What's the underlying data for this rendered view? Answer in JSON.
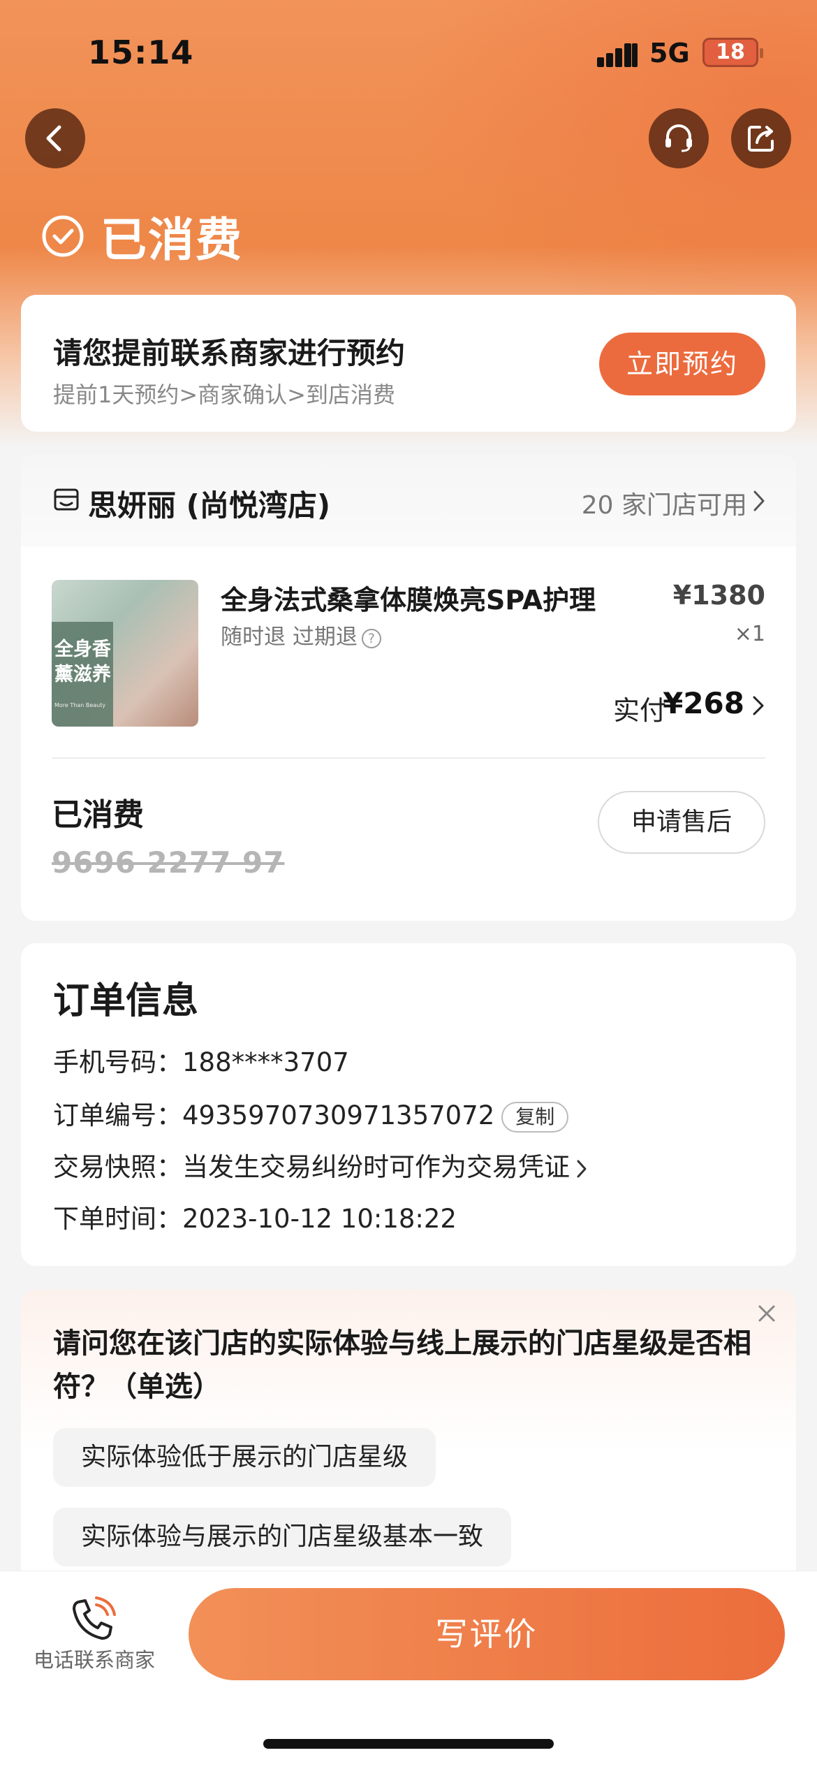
{
  "status_bar": {
    "time": "15:14",
    "network": "5G",
    "battery": "18",
    "battery_color": "#e2603f"
  },
  "nav": {
    "back_icon": "chevron-left-icon",
    "service_icon": "headset-icon",
    "share_icon": "share-icon"
  },
  "order_status": {
    "text": "已消费",
    "icon": "check-circle-icon"
  },
  "booking": {
    "title": "请您提前联系商家进行预约",
    "steps": "提前1天预约>商家确认>到店消费",
    "button": "立即预约"
  },
  "store": {
    "name": "思妍丽 (尚悦湾店)",
    "available": "20 家门店可用"
  },
  "product": {
    "thumb_text": "全身香薰滋养",
    "thumb_sub": "More Than Beauty",
    "name": "全身法式桑拿体膜焕亮SPA护理",
    "original_price": "¥1380",
    "refund_policy": "随时退 过期退",
    "quantity": "×1",
    "paid_label": "实付",
    "paid_amount": "¥268"
  },
  "voucher": {
    "status": "已消费",
    "code": "9696 2277 97",
    "aftersale_button": "申请售后"
  },
  "order_info": {
    "title": "订单信息",
    "phone_key": "手机号码：",
    "phone_value": "188****3707",
    "order_no_key": "订单编号：",
    "order_no_value": "4935970730971357072",
    "copy_button": "复制",
    "snapshot_key": "交易快照：",
    "snapshot_value": "当发生交易纠纷时可作为交易凭证",
    "time_key": "下单时间：",
    "time_value": "2023-10-12 10:18:22"
  },
  "survey": {
    "question": "请问您在该门店的实际体验与线上展示的门店星级是否相符？（单选）",
    "options": [
      "实际体验低于展示的门店星级",
      "实际体验与展示的门店星级基本一致"
    ]
  },
  "bottom": {
    "call_label": "电话联系商家",
    "review_button": "写评价",
    "accent": "#ec6d3c"
  }
}
